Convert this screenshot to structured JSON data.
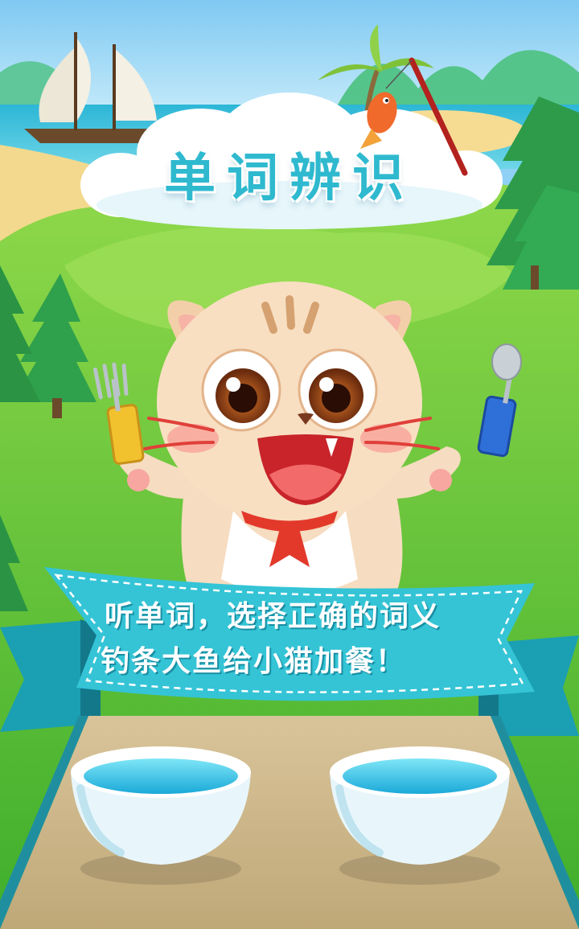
{
  "title": "单词辨识",
  "banner": {
    "line1": "听单词，选择正确的词义",
    "line2": "钓条大鱼给小猫加餐！"
  },
  "icons": {
    "sailboat": "sailboat-icon",
    "fish": "fish-icon",
    "fishing_rod": "fishing-rod-icon",
    "fork": "fork-icon",
    "spoon": "spoon-icon",
    "cat": "cat-character",
    "bowl": "bowl-icon"
  },
  "colors": {
    "title": "#2fb9cf",
    "ribbon": "#34c4d6",
    "grass": "#5bc43a",
    "table": "#c9b48a"
  }
}
